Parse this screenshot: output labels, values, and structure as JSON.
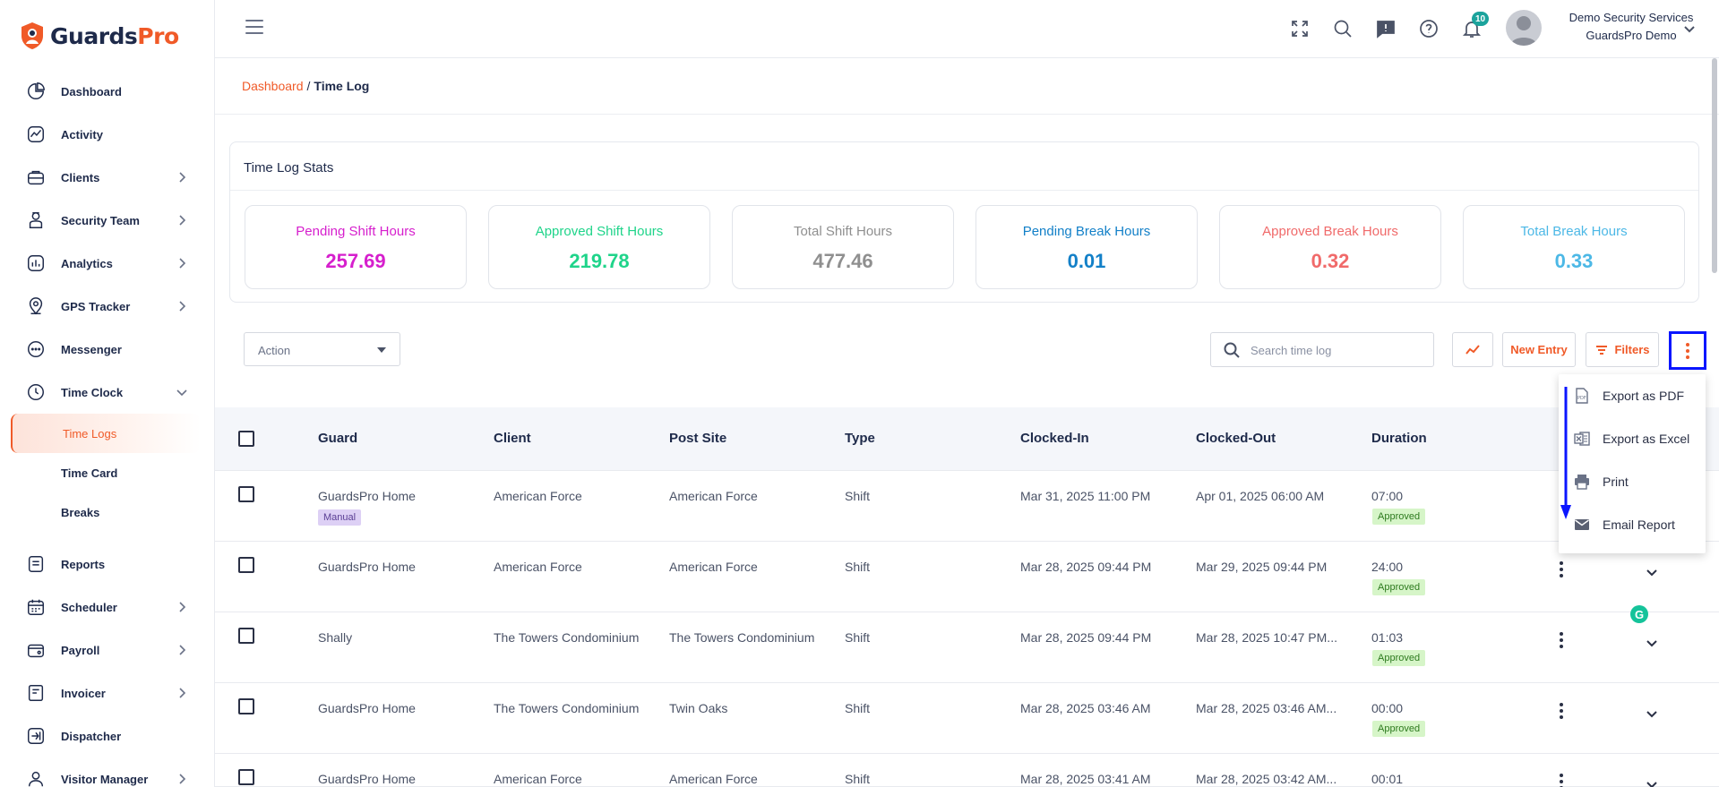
{
  "brand": {
    "name_part1": "Guards",
    "name_part2": "Pro",
    "primary_color": "#f05a28",
    "dark_color": "#1e2a4a"
  },
  "sidebar": {
    "items": [
      {
        "label": "Dashboard",
        "icon": "dashboard-icon",
        "has_children": false
      },
      {
        "label": "Activity",
        "icon": "activity-icon",
        "has_children": false
      },
      {
        "label": "Clients",
        "icon": "clients-icon",
        "has_children": true
      },
      {
        "label": "Security Team",
        "icon": "security-team-icon",
        "has_children": true
      },
      {
        "label": "Analytics",
        "icon": "analytics-icon",
        "has_children": true
      },
      {
        "label": "GPS Tracker",
        "icon": "gps-icon",
        "has_children": true
      },
      {
        "label": "Messenger",
        "icon": "messenger-icon",
        "has_children": false
      },
      {
        "label": "Time Clock",
        "icon": "clock-icon",
        "has_children": true,
        "expanded": true
      }
    ],
    "time_clock_children": [
      {
        "label": "Time Logs",
        "active": true
      },
      {
        "label": "Time Card",
        "active": false
      },
      {
        "label": "Breaks",
        "active": false
      }
    ],
    "items_after": [
      {
        "label": "Reports",
        "icon": "reports-icon",
        "has_children": false
      },
      {
        "label": "Scheduler",
        "icon": "scheduler-icon",
        "has_children": true
      },
      {
        "label": "Payroll",
        "icon": "payroll-icon",
        "has_children": true
      },
      {
        "label": "Invoicer",
        "icon": "invoicer-icon",
        "has_children": true
      },
      {
        "label": "Dispatcher",
        "icon": "dispatcher-icon",
        "has_children": false
      },
      {
        "label": "Visitor Manager",
        "icon": "visitor-icon",
        "has_children": true
      }
    ]
  },
  "header": {
    "notification_count": "10",
    "user_name": "Demo Security Services",
    "user_sub": "GuardsPro Demo"
  },
  "breadcrumb": {
    "home": "Dashboard",
    "separator": "/",
    "current": "Time Log"
  },
  "stats": {
    "title": "Time Log Stats",
    "boxes": [
      {
        "label": "Pending Shift Hours",
        "value": "257.69",
        "color": "#d61fcd"
      },
      {
        "label": "Approved Shift Hours",
        "value": "219.78",
        "color": "#1fd48a"
      },
      {
        "label": "Total Shift Hours",
        "value": "477.46",
        "color": "#8f8f8f"
      },
      {
        "label": "Pending Break Hours",
        "value": "0.01",
        "color": "#1380c8"
      },
      {
        "label": "Approved Break Hours",
        "value": "0.32",
        "color": "#f06a6a"
      },
      {
        "label": "Total Break Hours",
        "value": "0.33",
        "color": "#4cb8e6"
      }
    ]
  },
  "toolbar": {
    "action_label": "Action",
    "search_placeholder": "Search time log",
    "new_entry_label": "New Entry",
    "filters_label": "Filters"
  },
  "table": {
    "headers": [
      "Guard",
      "Client",
      "Post Site",
      "Type",
      "Clocked-In",
      "Clocked-Out",
      "Duration"
    ],
    "rows": [
      {
        "guard": "GuardsPro Home",
        "tag": "Manual",
        "client": "American Force",
        "post_site": "American Force",
        "type": "Shift",
        "clocked_in": "Mar 31, 2025 11:00 PM",
        "clocked_out": "Apr 01, 2025 06:00 AM",
        "duration": "07:00",
        "status": "Approved"
      },
      {
        "guard": "GuardsPro Home",
        "tag": "",
        "client": "American Force",
        "post_site": "American Force",
        "type": "Shift",
        "clocked_in": "Mar 28, 2025 09:44 PM",
        "clocked_out": "Mar 29, 2025 09:44 PM",
        "duration": "24:00",
        "status": "Approved"
      },
      {
        "guard": "Shally",
        "tag": "",
        "client": "The Towers Condominium",
        "post_site": "The Towers Condominium",
        "type": "Shift",
        "clocked_in": "Mar 28, 2025 09:44 PM",
        "clocked_out": "Mar 28, 2025 10:47 PM...",
        "duration": "01:03",
        "status": "Approved"
      },
      {
        "guard": "GuardsPro Home",
        "tag": "",
        "client": "The Towers Condominium",
        "post_site": "Twin Oaks",
        "type": "Shift",
        "clocked_in": "Mar 28, 2025 03:46 AM",
        "clocked_out": "Mar 28, 2025 03:46 AM...",
        "duration": "00:00",
        "status": "Approved"
      },
      {
        "guard": "GuardsPro Home",
        "tag": "",
        "client": "American Force",
        "post_site": "American Force",
        "type": "Shift",
        "clocked_in": "Mar 28, 2025 03:41 AM",
        "clocked_out": "Mar 28, 2025 03:42 AM...",
        "duration": "00:01",
        "status": ""
      }
    ]
  },
  "export_menu": {
    "items": [
      {
        "label": "Export as PDF",
        "icon": "pdf-icon"
      },
      {
        "label": "Export as Excel",
        "icon": "excel-icon"
      },
      {
        "label": "Print",
        "icon": "print-icon"
      },
      {
        "label": "Email Report",
        "icon": "email-icon"
      }
    ]
  }
}
